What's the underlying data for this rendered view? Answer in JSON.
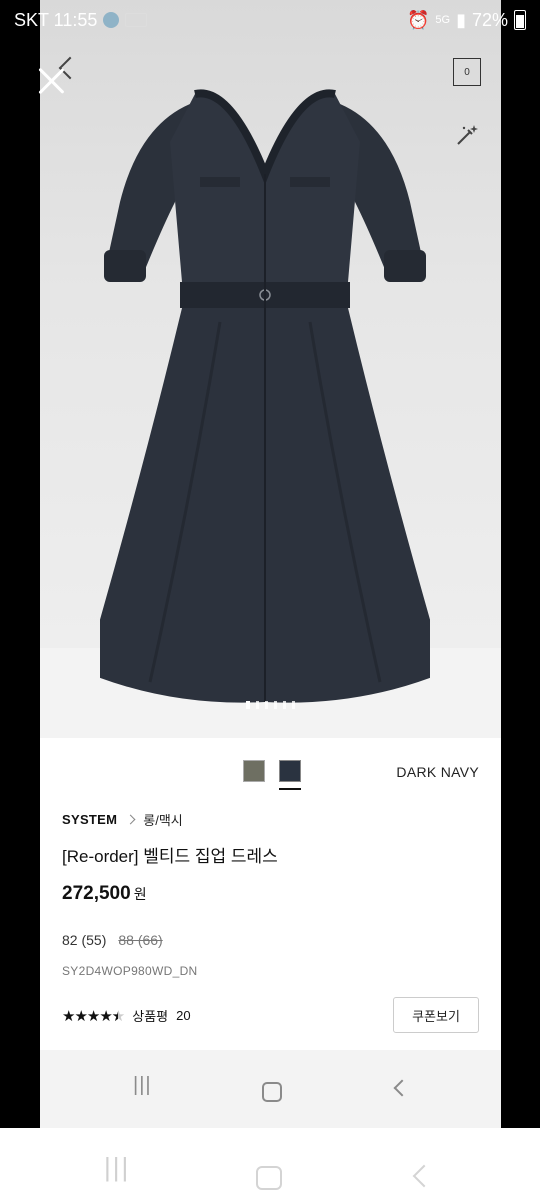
{
  "status_bar": {
    "carrier_time": "SKT 11:55",
    "battery": "72%",
    "network": "5G"
  },
  "header": {
    "cart_count": "0"
  },
  "gallery": {
    "image_count": 6,
    "active_index": 0
  },
  "product": {
    "color_name": "DARK NAVY",
    "colors": [
      {
        "name": "olive",
        "hex": "#6e6f62"
      },
      {
        "name": "dark navy",
        "hex": "#2a3340",
        "selected": true
      }
    ],
    "brand": "SYSTEM",
    "category": "롱/맥시",
    "title": "[Re-order] 벨티드 집업 드레스",
    "price": "272,500",
    "currency": "원",
    "size_available": "82 (55)",
    "size_soldout": "88 (66)",
    "sku": "SY2D4WOP980WD_DN",
    "stars": "★★★★★",
    "rating_value": 4.5,
    "review_label": "상품평",
    "review_count": "20",
    "coupon_label": "쿠폰보기"
  },
  "nav": {
    "recent_glyph": "|||"
  }
}
